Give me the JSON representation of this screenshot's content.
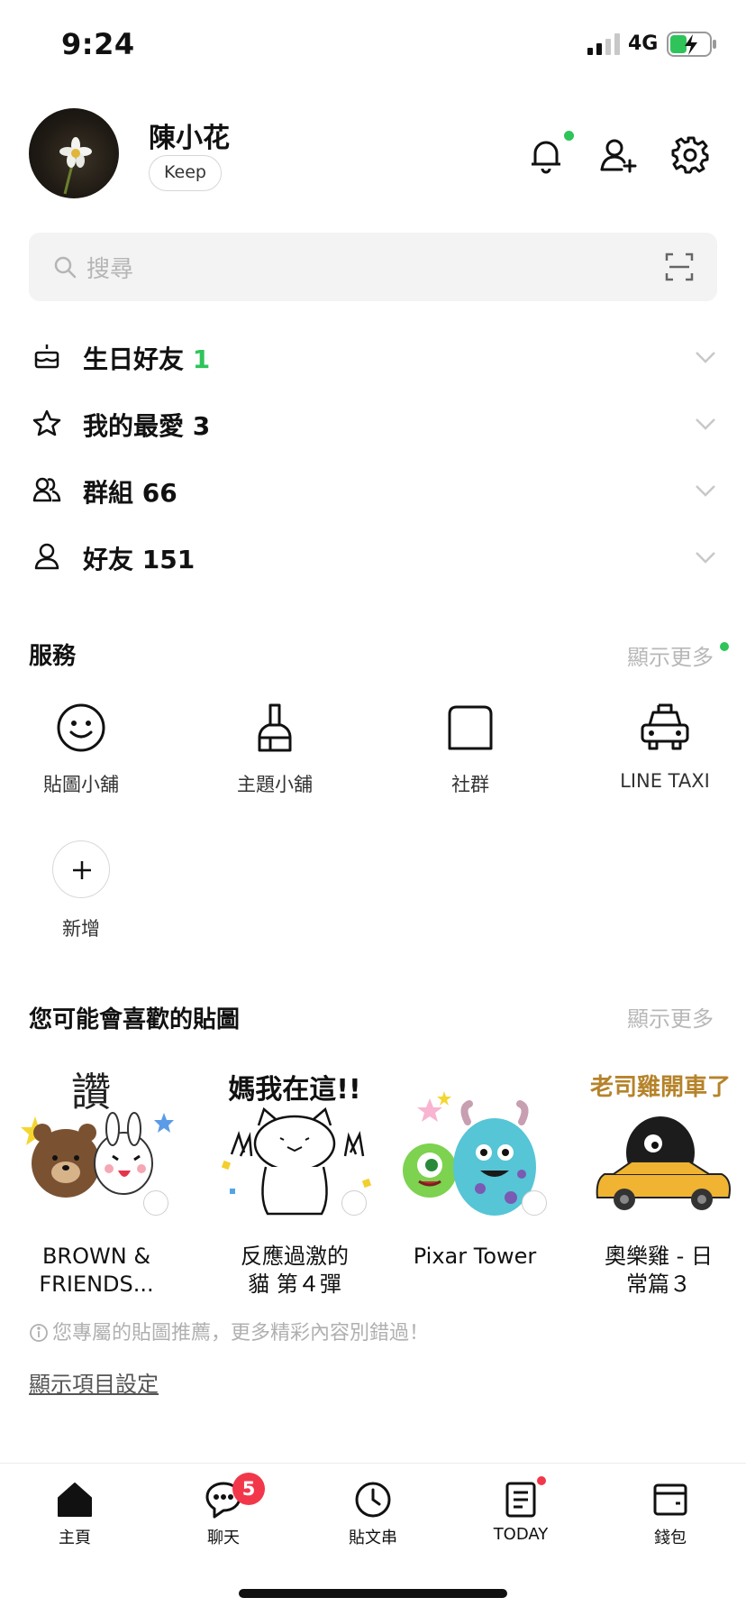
{
  "status_bar": {
    "time": "9:24",
    "network": "4G",
    "signal_bars": 2,
    "battery_charging": true
  },
  "profile": {
    "name": "陳小花",
    "keep_label": "Keep",
    "notification_dot": true
  },
  "search": {
    "placeholder": "搜尋"
  },
  "friend_sections": [
    {
      "label": "生日好友",
      "count": "1",
      "count_green": true,
      "icon": "birthday-cake-icon"
    },
    {
      "label": "我的最愛",
      "count": "3",
      "count_green": false,
      "icon": "star-icon"
    },
    {
      "label": "群組",
      "count": "66",
      "count_green": false,
      "icon": "group-icon"
    },
    {
      "label": "好友",
      "count": "151",
      "count_green": false,
      "icon": "person-icon"
    }
  ],
  "services": {
    "title": "服務",
    "more": "顯示更多",
    "items": [
      {
        "label": "貼圖小舖",
        "icon": "smiley-icon"
      },
      {
        "label": "主題小舖",
        "icon": "brush-icon"
      },
      {
        "label": "社群",
        "icon": "square-speech-icon"
      },
      {
        "label": "LINE TAXI",
        "icon": "taxi-icon"
      }
    ],
    "add_label": "新增"
  },
  "stickers": {
    "title": "您可能會喜歡的貼圖",
    "more": "顯示更多",
    "items": [
      {
        "name": "BROWN &\nFRIENDS...",
        "art_text": "讚"
      },
      {
        "name": "反應過激的\n貓 第４彈",
        "art_text": "媽我在這!!"
      },
      {
        "name": "Pixar Tower",
        "art_text": ""
      },
      {
        "name": "奧樂雞 - 日\n常篇３",
        "art_text": "老司雞開車了"
      }
    ],
    "note": "您專屬的貼圖推薦，更多精彩內容別錯過！",
    "settings_link": "顯示項目設定"
  },
  "tabbar": {
    "items": [
      {
        "label": "主頁",
        "icon": "home-icon",
        "badge": ""
      },
      {
        "label": "聊天",
        "icon": "chat-icon",
        "badge": "5"
      },
      {
        "label": "貼文串",
        "icon": "clock-icon",
        "badge": ""
      },
      {
        "label": "TODAY",
        "icon": "today-icon",
        "badge": ""
      },
      {
        "label": "錢包",
        "icon": "wallet-icon",
        "badge": ""
      }
    ]
  },
  "colors": {
    "accent_green": "#2ec45a",
    "badge_red": "#f2374b",
    "muted_text": "#b8b8b8"
  }
}
